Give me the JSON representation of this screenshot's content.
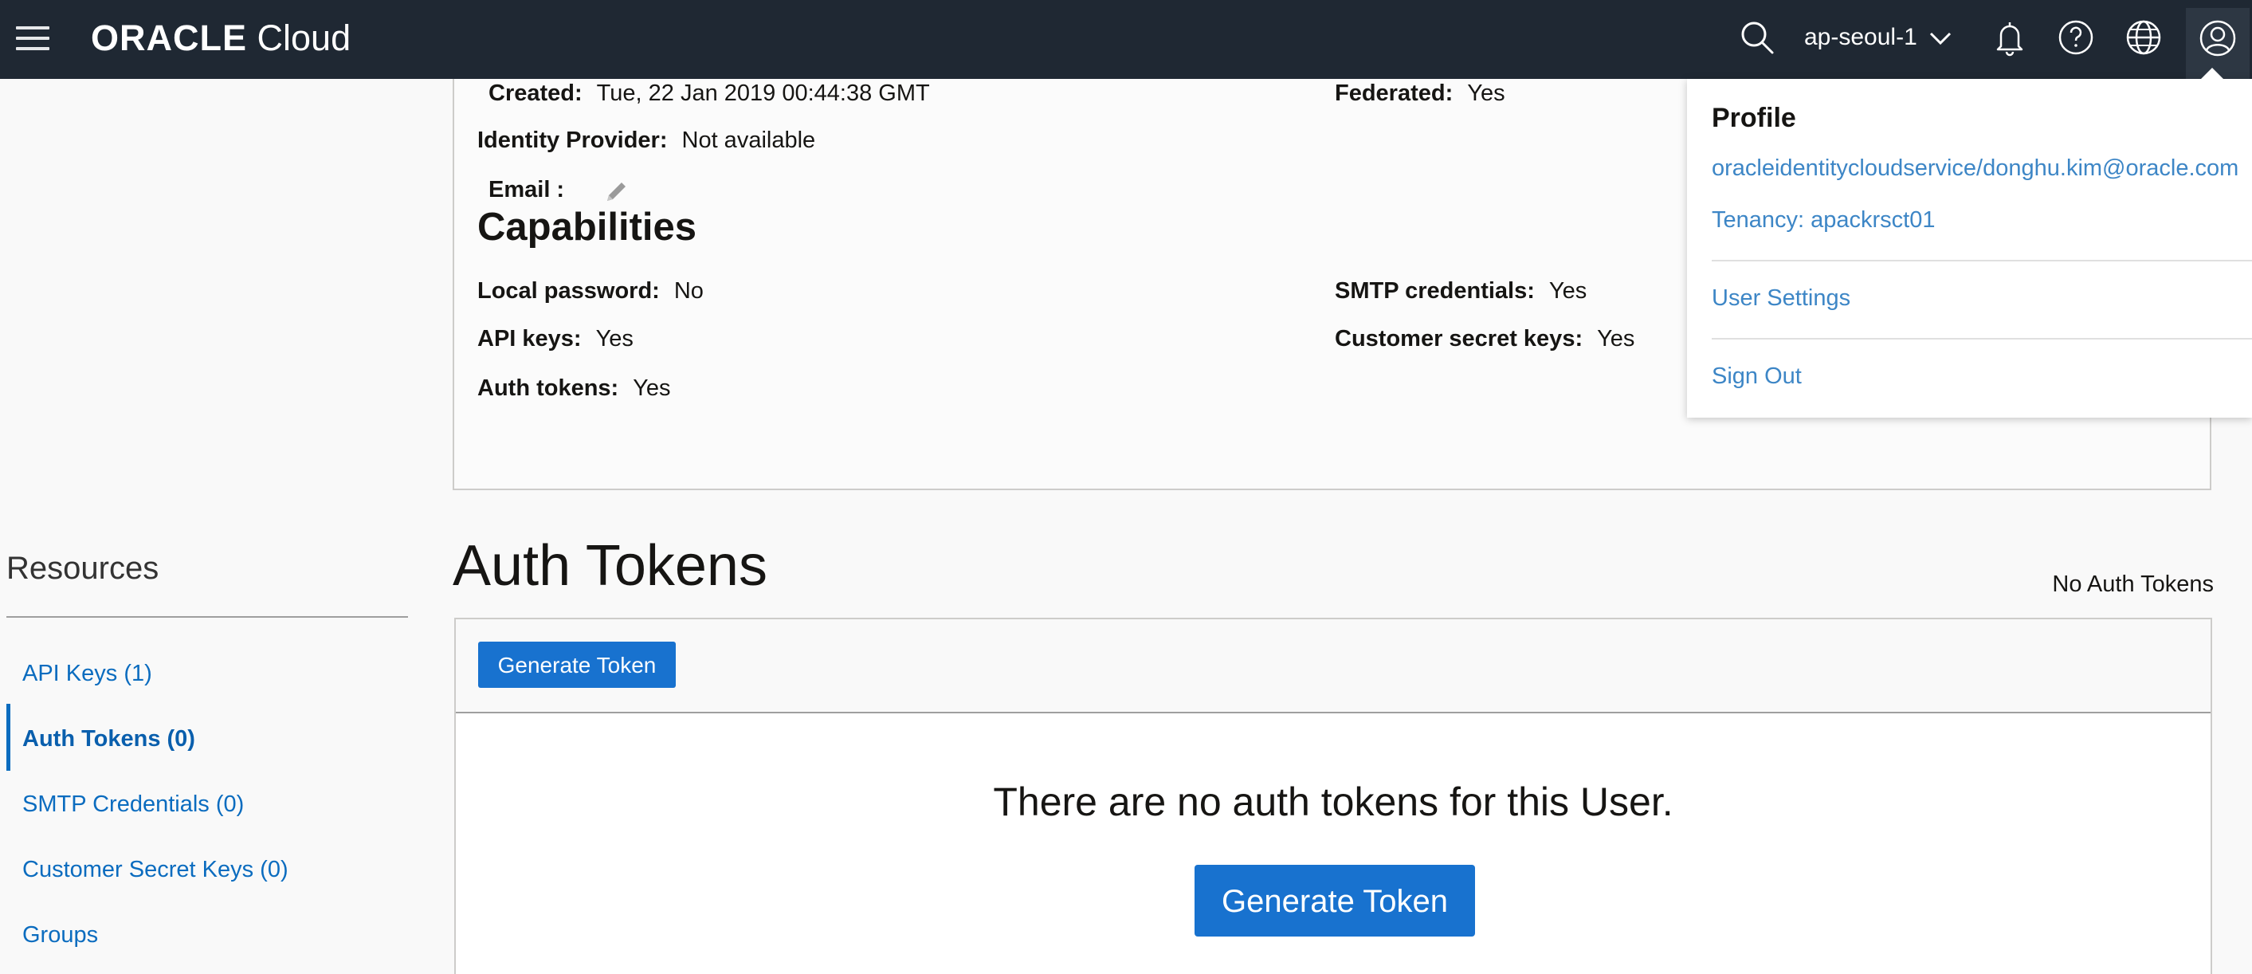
{
  "header": {
    "brand_strong": "ORACLE",
    "brand_light": "Cloud",
    "region": "ap-seoul-1"
  },
  "details": {
    "created_label": "Created:",
    "created_value": "Tue, 22 Jan 2019 00:44:38 GMT",
    "federated_label": "Federated:",
    "federated_value": "Yes",
    "idp_label": "Identity Provider:",
    "idp_value": "Not available",
    "email_label": "Email :",
    "capabilities_title": "Capabilities",
    "local_password_label": "Local password:",
    "local_password_value": "No",
    "smtp_label": "SMTP credentials:",
    "smtp_value": "Yes",
    "api_keys_label": "API keys:",
    "api_keys_value": "Yes",
    "customer_secret_label": "Customer secret keys:",
    "customer_secret_value": "Yes",
    "auth_tokens_label": "Auth tokens:",
    "auth_tokens_value": "Yes"
  },
  "resources": {
    "title": "Resources",
    "items": [
      {
        "label": "API Keys (1)"
      },
      {
        "label": "Auth Tokens (0)"
      },
      {
        "label": "SMTP Credentials (0)"
      },
      {
        "label": "Customer Secret Keys (0)"
      },
      {
        "label": "Groups"
      }
    ]
  },
  "auth_tokens": {
    "title": "Auth Tokens",
    "status": "No Auth Tokens",
    "generate_label": "Generate Token",
    "empty_message": "There are no auth tokens for this User.",
    "generate_large_label": "Generate Token"
  },
  "profile_menu": {
    "title": "Profile",
    "user": "oracleidentitycloudservice/donghu.kim@oracle.com",
    "tenancy": "Tenancy: apackrsct01",
    "user_settings": "User Settings",
    "sign_out": "Sign Out"
  },
  "colors": {
    "header_bg": "#1f2833",
    "link": "#0b6cbf",
    "primary_button": "#1872cf",
    "popover_link": "#3d86c6"
  },
  "icons": [
    "menu-icon",
    "search-icon",
    "chevron-down-icon",
    "bell-icon",
    "help-icon",
    "globe-icon",
    "user-icon",
    "pencil-icon"
  ]
}
